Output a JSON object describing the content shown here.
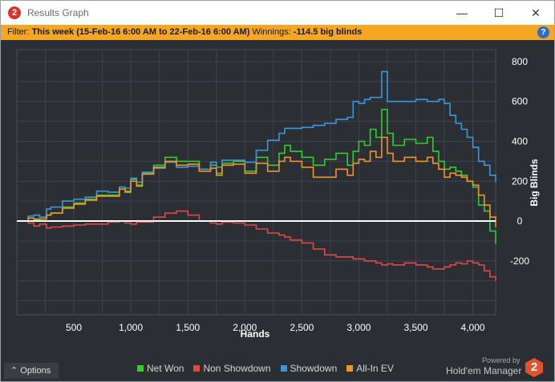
{
  "window": {
    "logo_glyph": "2",
    "title": "Results Graph",
    "minimize_glyph": "—",
    "maximize_glyph": "☐",
    "close_glyph": "✕"
  },
  "filter": {
    "label": "Filter: ",
    "value": "This week (15-Feb-16 6:00 AM to 22-Feb-16 6:00 AM)",
    "winnings_label": " Winnings: ",
    "winnings_value": "-114.5 big blinds",
    "help_glyph": "?"
  },
  "chart_data": {
    "type": "line",
    "xlabel": "Hands",
    "ylabel": "Big Blinds",
    "xlim": [
      0,
      4200
    ],
    "ylim": [
      -470,
      860
    ],
    "x_ticks": [
      500,
      1000,
      1500,
      2000,
      2500,
      3000,
      3500,
      4000
    ],
    "x_tick_labels": [
      "500",
      "1,000",
      "1,500",
      "2,000",
      "2,500",
      "3,000",
      "3,500",
      "4,000"
    ],
    "y_ticks": [
      -200,
      0,
      200,
      400,
      600,
      800
    ],
    "y_tick_labels": [
      "-200",
      "0",
      "200",
      "400",
      "600",
      "800"
    ],
    "grid": true,
    "legend_position": "bottom",
    "series": [
      {
        "name": "Net Won",
        "color": "#33cc33",
        "x": [
          0,
          100,
          150,
          200,
          260,
          300,
          400,
          500,
          600,
          700,
          800,
          900,
          950,
          1000,
          1050,
          1100,
          1200,
          1300,
          1400,
          1500,
          1600,
          1700,
          1750,
          1800,
          1900,
          2000,
          2100,
          2200,
          2300,
          2350,
          2400,
          2500,
          2600,
          2700,
          2800,
          2900,
          2950,
          3000,
          3050,
          3100,
          3150,
          3200,
          3250,
          3300,
          3400,
          3500,
          3600,
          3650,
          3700,
          3750,
          3800,
          3850,
          3900,
          3950,
          4000,
          4050,
          4100,
          4150,
          4200
        ],
        "y": [
          0,
          15,
          5,
          10,
          30,
          40,
          70,
          90,
          110,
          130,
          130,
          170,
          150,
          210,
          180,
          240,
          280,
          320,
          300,
          300,
          260,
          280,
          240,
          290,
          300,
          250,
          320,
          280,
          340,
          380,
          350,
          320,
          280,
          310,
          340,
          280,
          350,
          400,
          380,
          460,
          420,
          560,
          440,
          380,
          410,
          390,
          420,
          350,
          300,
          260,
          270,
          250,
          230,
          200,
          170,
          80,
          50,
          -50,
          -114.5
        ]
      },
      {
        "name": "Non Showdown",
        "color": "#e04848",
        "x": [
          0,
          100,
          150,
          200,
          260,
          300,
          400,
          500,
          600,
          700,
          800,
          900,
          950,
          1000,
          1050,
          1100,
          1200,
          1300,
          1400,
          1500,
          1600,
          1700,
          1750,
          1800,
          1900,
          2000,
          2100,
          2200,
          2300,
          2350,
          2400,
          2500,
          2600,
          2700,
          2800,
          2900,
          2950,
          3000,
          3050,
          3100,
          3150,
          3200,
          3250,
          3300,
          3400,
          3500,
          3600,
          3650,
          3700,
          3750,
          3800,
          3850,
          3900,
          3950,
          4000,
          4050,
          4100,
          4150,
          4200
        ],
        "y": [
          0,
          -10,
          -25,
          -15,
          -35,
          -30,
          -25,
          -20,
          -15,
          -15,
          -5,
          0,
          -10,
          -15,
          -5,
          -5,
          20,
          40,
          50,
          30,
          0,
          -10,
          -15,
          -5,
          -10,
          -20,
          -40,
          -60,
          -70,
          -80,
          -95,
          -110,
          -140,
          -170,
          -180,
          -180,
          -190,
          -190,
          -200,
          -200,
          -210,
          -220,
          -215,
          -220,
          -210,
          -220,
          -230,
          -240,
          -240,
          -230,
          -220,
          -210,
          -215,
          -200,
          -210,
          -220,
          -250,
          -280,
          -300
        ]
      },
      {
        "name": "Showdown",
        "color": "#3d96dd",
        "x": [
          0,
          100,
          150,
          200,
          260,
          300,
          400,
          500,
          600,
          700,
          800,
          900,
          950,
          1000,
          1050,
          1100,
          1200,
          1300,
          1400,
          1500,
          1600,
          1700,
          1750,
          1800,
          1900,
          2000,
          2100,
          2200,
          2300,
          2350,
          2400,
          2500,
          2600,
          2700,
          2800,
          2900,
          2950,
          3000,
          3050,
          3100,
          3150,
          3200,
          3250,
          3300,
          3400,
          3500,
          3600,
          3650,
          3700,
          3750,
          3800,
          3850,
          3900,
          3950,
          4000,
          4050,
          4100,
          4150,
          4200
        ],
        "y": [
          0,
          25,
          30,
          20,
          60,
          70,
          100,
          110,
          120,
          150,
          145,
          170,
          165,
          215,
          195,
          245,
          265,
          295,
          270,
          275,
          260,
          295,
          270,
          305,
          305,
          295,
          355,
          405,
          440,
          465,
          465,
          470,
          480,
          490,
          510,
          520,
          600,
          590,
          610,
          620,
          620,
          750,
          600,
          600,
          600,
          610,
          600,
          600,
          610,
          590,
          530,
          490,
          460,
          420,
          370,
          300,
          280,
          230,
          195
        ]
      },
      {
        "name": "All-In EV",
        "color": "#f0952a",
        "x": [
          0,
          100,
          150,
          200,
          260,
          300,
          400,
          500,
          600,
          700,
          800,
          900,
          950,
          1000,
          1050,
          1100,
          1200,
          1300,
          1400,
          1500,
          1600,
          1700,
          1750,
          1800,
          1900,
          2000,
          2100,
          2200,
          2300,
          2350,
          2400,
          2500,
          2600,
          2700,
          2800,
          2900,
          2950,
          3000,
          3050,
          3100,
          3150,
          3200,
          3250,
          3300,
          3400,
          3500,
          3600,
          3650,
          3700,
          3750,
          3800,
          3850,
          3900,
          3950,
          4000,
          4050,
          4100,
          4150,
          4200
        ],
        "y": [
          0,
          15,
          10,
          10,
          30,
          40,
          65,
          85,
          105,
          125,
          125,
          160,
          145,
          200,
          175,
          235,
          270,
          300,
          280,
          285,
          250,
          265,
          230,
          280,
          285,
          240,
          290,
          250,
          300,
          320,
          300,
          270,
          220,
          220,
          260,
          230,
          290,
          310,
          300,
          350,
          320,
          420,
          340,
          300,
          320,
          300,
          320,
          290,
          260,
          220,
          240,
          230,
          220,
          200,
          180,
          130,
          80,
          20,
          -30
        ]
      }
    ]
  },
  "legend": {
    "items": [
      {
        "label": "Net Won",
        "color": "#33cc33"
      },
      {
        "label": "Non Showdown",
        "color": "#e04848"
      },
      {
        "label": "Showdown",
        "color": "#3d96dd"
      },
      {
        "label": "All-In EV",
        "color": "#f0952a"
      }
    ]
  },
  "footer": {
    "options_label": "Options",
    "options_icon": "⌃",
    "powered_by": "Powered by",
    "brand": "Hold'em Manager",
    "brand_badge": "2"
  },
  "colors": {
    "filter_bar": "#f5a623",
    "chart_background": "#2b2e33",
    "grid": "#3e434a",
    "zero_line": "#ffffff",
    "logo_red": "#d8322a"
  }
}
